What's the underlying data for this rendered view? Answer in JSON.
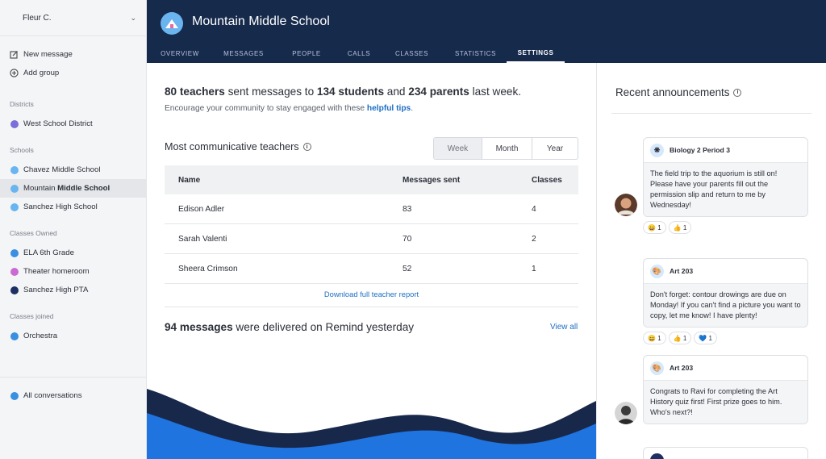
{
  "sidebar": {
    "user_name": "Fleur C.",
    "actions": [
      {
        "label": "New message",
        "icon": "edit-icon"
      },
      {
        "label": "Add group",
        "icon": "plus-circle-icon"
      }
    ],
    "districts_heading": "Districts",
    "districts": [
      {
        "label": "West School District",
        "color": "#7a6fd8"
      }
    ],
    "schools_heading": "Schools",
    "schools": [
      {
        "label": "Chavez Middle School",
        "color": "#6ab4f0"
      },
      {
        "label_pre": "Mountain ",
        "label_bold": "Middle School",
        "color": "#6ab4f0"
      },
      {
        "label": "Sanchez High School",
        "color": "#6ab4f0"
      }
    ],
    "owned_heading": "Classes Owned",
    "owned": [
      {
        "label": "ELA 6th Grade",
        "color": "#3a8fe0"
      },
      {
        "label": "Theater homeroom",
        "color": "#c96bd2"
      },
      {
        "label": "Sanchez High PTA",
        "color": "#1d2f63"
      }
    ],
    "joined_heading": "Classes joined",
    "joined": [
      {
        "label": "Orchestra",
        "color": "#3a8fe0"
      }
    ],
    "all_conversations": "All conversations"
  },
  "header": {
    "school_name": "Mountain Middle School",
    "tabs": [
      "OVERVIEW",
      "MESSAGES",
      "PEOPLE",
      "CALLS",
      "CLASSES",
      "STATISTICS",
      "SETTINGS"
    ],
    "active_tab": "SETTINGS"
  },
  "main": {
    "summary": {
      "teachers": "80 teachers",
      "t1": " sent messages to ",
      "students": "134 students",
      "t2": " and ",
      "parents": "234 parents",
      "t3": " last week."
    },
    "encourage_text": "Encourage your community to stay engaged with these ",
    "tips_link": "helpful tips",
    "tips_period": ".",
    "teachers_title": "Most communicative teachers",
    "periods": [
      "Week",
      "Month",
      "Year"
    ],
    "selected_period": "Week",
    "table": {
      "headers": [
        "Name",
        "Messages sent",
        "Classes"
      ],
      "rows": [
        [
          "Edison Adler",
          "83",
          "4"
        ],
        [
          "Sarah Valenti",
          "70",
          "2"
        ],
        [
          "Sheera Crimson",
          "52",
          "1"
        ]
      ]
    },
    "download_link": "Download full teacher report",
    "delivered_bold": "94 messages",
    "delivered_rest": " were delivered on Remind yesterday",
    "view_all": "View all"
  },
  "announcements": {
    "title": "Recent announcements",
    "items": [
      {
        "class_name": "Biology 2 Period 3",
        "text": "The field trip to the aquorium is still on! Please have your parents fill out the permission slip and return to me by Wednesday!",
        "reactions": [
          {
            "emoji": "😄",
            "count": "1"
          },
          {
            "emoji": "👍",
            "count": "1"
          }
        ]
      },
      {
        "class_name": "Art 203",
        "text": "Don't forget: contour drowings are due on Monday! If you can't find a picture you want to copy, let me know! I have plenty!",
        "reactions": [
          {
            "emoji": "😄",
            "count": "1"
          },
          {
            "emoji": "👍",
            "count": "1"
          },
          {
            "emoji": "💙",
            "count": "1"
          }
        ]
      },
      {
        "class_name": "Art 203",
        "text": "Congrats to Ravi for completing the Art History quiz first! First prize goes to him. Who's next?!",
        "reactions": []
      }
    ]
  }
}
